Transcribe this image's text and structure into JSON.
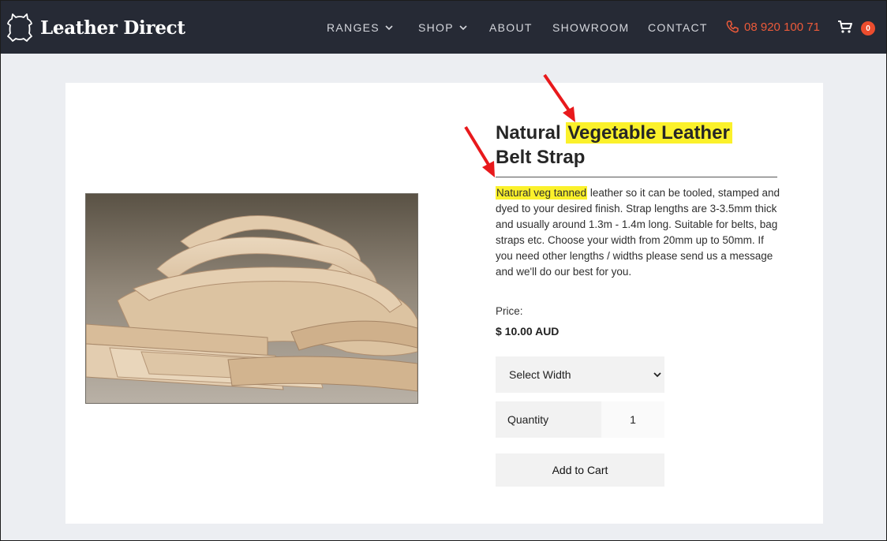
{
  "brand": {
    "name": "Leather Direct"
  },
  "nav": {
    "items": [
      {
        "label": "RANGES",
        "has_dropdown": true
      },
      {
        "label": "SHOP",
        "has_dropdown": true
      },
      {
        "label": "ABOUT",
        "has_dropdown": false
      },
      {
        "label": "SHOWROOM",
        "has_dropdown": false
      },
      {
        "label": "CONTACT",
        "has_dropdown": false
      }
    ],
    "phone": "08 920 100 71",
    "cart_count": "0"
  },
  "product": {
    "title_part1": "Natural ",
    "title_highlight": "Vegetable Leather",
    "title_part2": "Belt Strap",
    "desc_highlight": "Natural veg tanned",
    "desc_rest": " leather so it can be tooled, stamped and dyed to your desired finish. Strap lengths are 3-3.5mm thick and usually around 1.3m - 1.4m long. Suitable for belts, bag straps etc. Choose your width from 20mm up to 50mm. If you need other lengths / widths please send us a message and we'll do our best for you.",
    "price_label": "Price:",
    "price": "$ 10.00 AUD",
    "select_width": "Select Width",
    "quantity_label": "Quantity",
    "quantity_value": "1",
    "add_to_cart": "Add to Cart"
  },
  "colors": {
    "header_bg": "#262a35",
    "accent": "#ec5a3a",
    "highlight": "#fbf12b",
    "annotation_arrow": "#e8191c"
  },
  "icons": [
    "leather-hide-icon",
    "chevron-down-icon",
    "phone-icon",
    "cart-icon",
    "arrow-annotation-icon"
  ]
}
